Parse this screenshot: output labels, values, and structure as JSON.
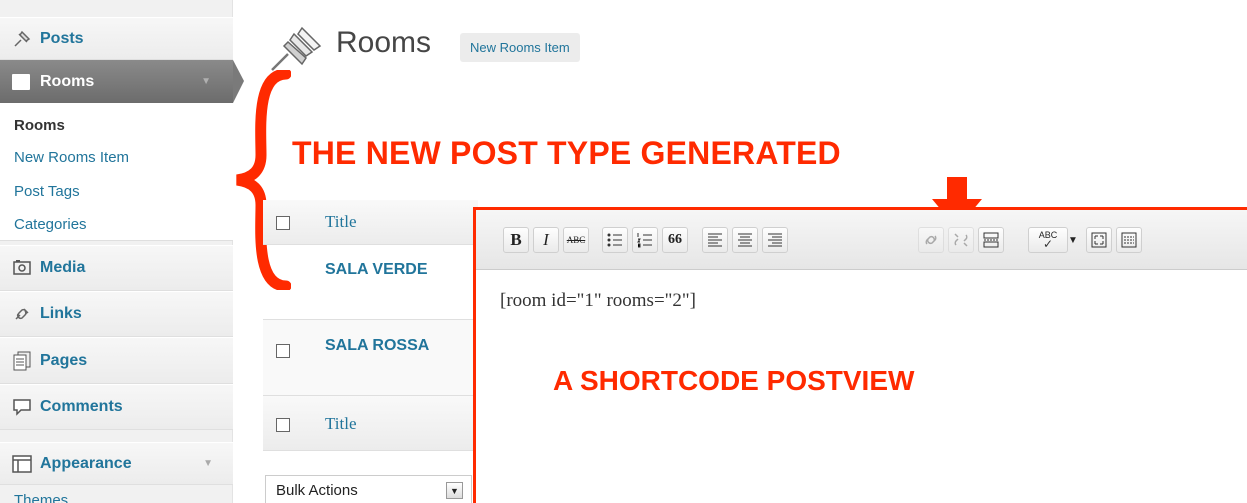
{
  "sidebar": {
    "top_items": [
      {
        "label": "Posts",
        "icon": "pushpin-icon"
      }
    ],
    "current": {
      "label": "Rooms",
      "icon": "rooms-icon"
    },
    "submenu": [
      "Rooms",
      "New Rooms Item",
      "Post Tags",
      "Categories"
    ],
    "items": [
      {
        "label": "Media",
        "icon": "media-icon"
      },
      {
        "label": "Links",
        "icon": "links-icon"
      },
      {
        "label": "Pages",
        "icon": "pages-icon"
      },
      {
        "label": "Comments",
        "icon": "comments-icon"
      },
      {
        "label": "Appearance",
        "icon": "appearance-icon"
      }
    ],
    "partial_item": "Themes"
  },
  "header": {
    "title": "Rooms",
    "add_new": "New Rooms Item"
  },
  "annotations": {
    "post_type": "THE NEW POST TYPE GENERATED",
    "shortcode": "A SHORTCODE POSTVIEW"
  },
  "table": {
    "header": "Title",
    "rows": [
      "SALA VERDE",
      "SALA ROSSA"
    ],
    "footer": "Title"
  },
  "bulk_actions": "Bulk Actions",
  "editor": {
    "toolbar": {
      "bold": "B",
      "italic": "I",
      "strike": "ABC",
      "quote": "66",
      "spell": "ABC"
    },
    "content": "[room id=\"1\" rooms=\"2\"]"
  },
  "colors": {
    "link": "#21759b",
    "annotation_red": "#ff2a00",
    "menu_current": "#7a7a7a"
  }
}
